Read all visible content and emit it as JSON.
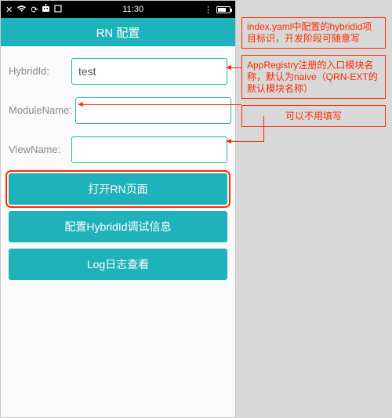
{
  "statusbar": {
    "time": "11:30",
    "icons_left": [
      "close",
      "wifi",
      "sync",
      "robot",
      "square"
    ],
    "icons_right": [
      "3dot",
      "battery"
    ]
  },
  "header": {
    "title": "RN 配置"
  },
  "form": {
    "rows": [
      {
        "label": "HybridId:",
        "value": "test"
      },
      {
        "label": "ModuleName:",
        "value": ""
      },
      {
        "label": "ViewName:",
        "value": ""
      }
    ]
  },
  "buttons": {
    "open": "打开RN页面",
    "config": "配置HybridId调试信息",
    "log": "Log日志查看"
  },
  "annotations": {
    "a1": "index.yaml中配置的hybridid项目标识，开发阶段可随意写",
    "a2": "AppRegistry注册的入口模块名称，默认为naive（QRN-EXT的默认模块名称）",
    "a3": "可以不用填写"
  },
  "colors": {
    "teal": "#1fb2bb",
    "red": "#ff2a00",
    "gray_bg": "#d8d8d8"
  }
}
